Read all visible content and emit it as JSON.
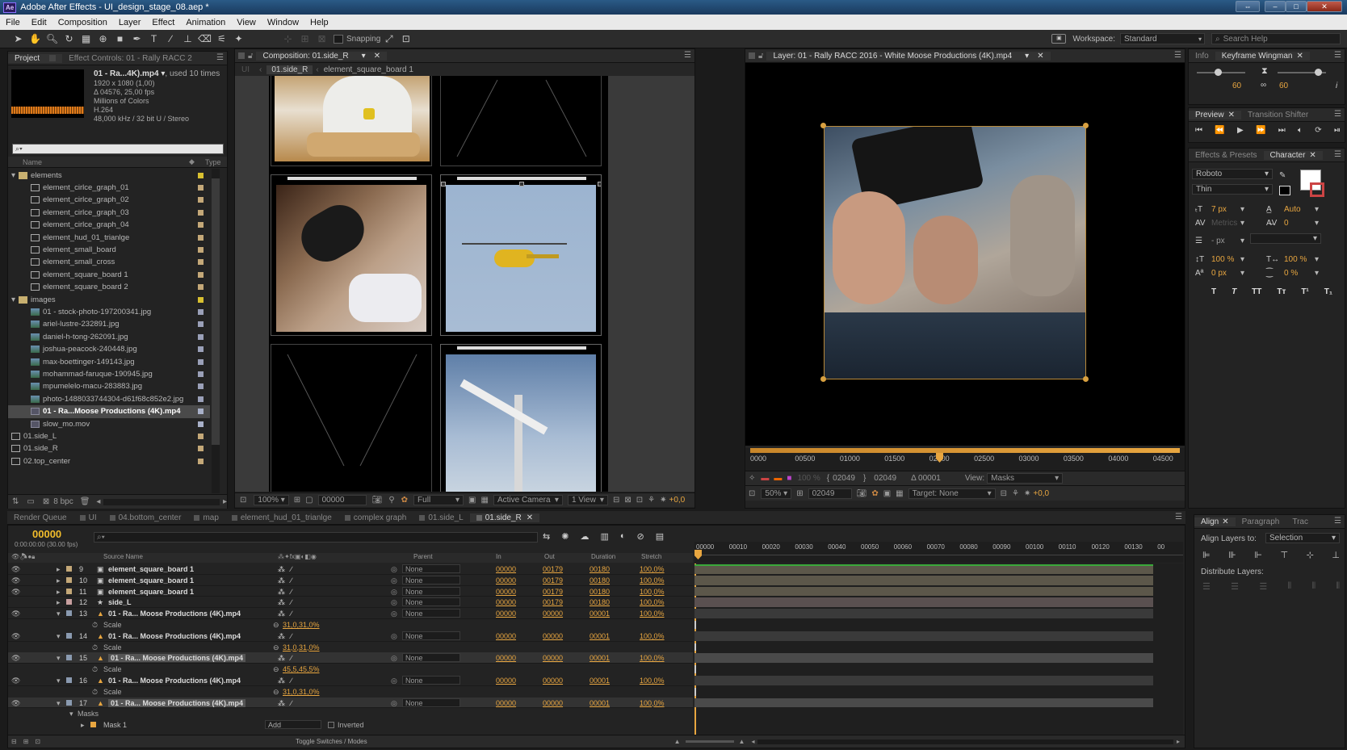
{
  "app": {
    "title": "Adobe After Effects - UI_design_stage_08.aep *",
    "badge": "Ae",
    "menus": [
      "File",
      "Edit",
      "Composition",
      "Layer",
      "Effect",
      "Animation",
      "View",
      "Window",
      "Help"
    ]
  },
  "toolbar": {
    "snapping_label": "Snapping",
    "workspace_label": "Workspace:",
    "workspace_value": "Standard",
    "search_placeholder": "Search Help"
  },
  "project": {
    "tabs": [
      "Project",
      "Effect Controls: 01 - Rally RACC 2"
    ],
    "info_name": "01 - Ra...4K).mp4",
    "info_used": ", used 10 times",
    "info_lines": [
      "1920 x 1080 (1,00)",
      "Δ 04576, 25,00 fps",
      "Millions of Colors",
      "H.264",
      "48,000 kHz / 32 bit U / Stereo"
    ],
    "col_name": "Name",
    "col_type": "Type",
    "items": [
      {
        "label": "elements",
        "kind": "folder"
      },
      {
        "label": "element_cirlce_graph_01",
        "kind": "comp"
      },
      {
        "label": "element_cirlce_graph_02",
        "kind": "comp"
      },
      {
        "label": "element_cirlce_graph_03",
        "kind": "comp"
      },
      {
        "label": "element_cirlce_graph_04",
        "kind": "comp"
      },
      {
        "label": "element_hud_01_trianlge",
        "kind": "comp"
      },
      {
        "label": "element_small_board",
        "kind": "comp"
      },
      {
        "label": "element_small_cross",
        "kind": "comp"
      },
      {
        "label": "element_square_board 1",
        "kind": "comp"
      },
      {
        "label": "element_square_board 2",
        "kind": "comp"
      },
      {
        "label": "images",
        "kind": "folder"
      },
      {
        "label": "01 - stock-photo-197200341.jpg",
        "kind": "image"
      },
      {
        "label": "ariel-lustre-232891.jpg",
        "kind": "image"
      },
      {
        "label": "daniel-h-tong-262091.jpg",
        "kind": "image"
      },
      {
        "label": "joshua-peacock-240448.jpg",
        "kind": "image"
      },
      {
        "label": "max-boettinger-149143.jpg",
        "kind": "image"
      },
      {
        "label": "mohammad-faruque-190945.jpg",
        "kind": "image"
      },
      {
        "label": "mpumelelo-macu-283883.jpg",
        "kind": "image"
      },
      {
        "label": "photo-1488033744304-d61f68c852e2.jpg",
        "kind": "image"
      },
      {
        "label": "01 - Ra...Moose Productions (4K).mp4",
        "kind": "video"
      },
      {
        "label": "slow_mo.mov",
        "kind": "video"
      },
      {
        "label": "01.side_L",
        "kind": "comp"
      },
      {
        "label": "01.side_R",
        "kind": "comp"
      },
      {
        "label": "02.top_center",
        "kind": "comp"
      }
    ],
    "bpc": "8 bpc"
  },
  "comp": {
    "tab": "Composition: 01.side_R",
    "crumbs": [
      "01.side_R",
      "element_square_board 1"
    ],
    "zoom": "100%",
    "timecode": "00000",
    "resolution": "Full",
    "camera": "Active Camera",
    "views": "1 View",
    "offset": "+0,0"
  },
  "layer": {
    "tab": "Layer: 01 - Rally RACC 2016 - White Moose Productions (4K).mp4",
    "ruler": [
      "0000",
      "00500",
      "01000",
      "01500",
      "02000",
      "02500",
      "03000",
      "03500",
      "04000",
      "04500"
    ],
    "zoom": "50%",
    "tc": "02049",
    "in": "02049",
    "out": "02049",
    "delta": "Δ 00001",
    "view_label": "View:",
    "view_value": "Masks",
    "target": "Target: None",
    "offset": "+0,0"
  },
  "right": {
    "info_tabs": [
      "Info",
      "Keyframe Wingman"
    ],
    "kw_values": [
      "60",
      "60"
    ],
    "preview_tabs": [
      "Preview",
      "Transition Shifter"
    ],
    "char_tabs": [
      "Effects & Presets",
      "Character"
    ],
    "font": "Roboto",
    "style": "Thin",
    "size": "7 px",
    "leading": "Auto",
    "kerning": "Metrics",
    "tracking": "0",
    "stroke": "- px",
    "vscale": "100 %",
    "hscale": "100 %",
    "baseline": "0 px",
    "tsume": "0 %",
    "styles": [
      "T",
      "T",
      "TT",
      "Tт",
      "T¹",
      "T₁"
    ],
    "align_tabs": [
      "Align",
      "Paragraph",
      "Trac"
    ],
    "align_to_label": "Align Layers to:",
    "align_to_value": "Selection",
    "distribute_label": "Distribute Layers:"
  },
  "timeline": {
    "tabs": [
      "Render Queue",
      "UI",
      "04.bottom_center",
      "map",
      "element_hud_01_trianlge",
      "complex graph",
      "01.side_L",
      "01.side_R"
    ],
    "timecode": "00000",
    "timecode_sub": "0:00:00:00 (30.00 fps)",
    "headers": {
      "source": "Source Name",
      "parent": "Parent",
      "in": "In",
      "out": "Out",
      "duration": "Duration",
      "stretch": "Stretch"
    },
    "ruler": [
      "00000",
      "00010",
      "00020",
      "00030",
      "00040",
      "00050",
      "00060",
      "00070",
      "00080",
      "00090",
      "00100",
      "00110",
      "00120",
      "00130",
      "00"
    ],
    "layers": [
      {
        "num": "9",
        "name": "element_square_board 1",
        "parent": "None",
        "in": "00000",
        "out": "00179",
        "dur": "00180",
        "stretch": "100,0%",
        "kind": "comp"
      },
      {
        "num": "10",
        "name": "element_square_board 1",
        "parent": "None",
        "in": "00000",
        "out": "00179",
        "dur": "00180",
        "stretch": "100,0%",
        "kind": "comp"
      },
      {
        "num": "11",
        "name": "element_square_board 1",
        "parent": "None",
        "in": "00000",
        "out": "00179",
        "dur": "00180",
        "stretch": "100,0%",
        "kind": "comp"
      },
      {
        "num": "12",
        "name": "side_L",
        "parent": "None",
        "in": "00000",
        "out": "00179",
        "dur": "00180",
        "stretch": "100,0%",
        "kind": "star"
      },
      {
        "num": "13",
        "name": "01 - Ra... Moose Productions (4K).mp4",
        "parent": "None",
        "in": "00000",
        "out": "00000",
        "dur": "00001",
        "stretch": "100,0%",
        "kind": "video",
        "prop": "Scale",
        "prop_value": "31,0,31,0%"
      },
      {
        "num": "14",
        "name": "01 - Ra... Moose Productions (4K).mp4",
        "parent": "None",
        "in": "00000",
        "out": "00000",
        "dur": "00001",
        "stretch": "100,0%",
        "kind": "video",
        "prop": "Scale",
        "prop_value": "31,0,31,0%"
      },
      {
        "num": "15",
        "name": "01 - Ra... Moose Productions (4K).mp4",
        "parent": "None",
        "in": "00000",
        "out": "00000",
        "dur": "00001",
        "stretch": "100,0%",
        "kind": "video",
        "prop": "Scale",
        "prop_value": "45,5,45,5%",
        "selected": true
      },
      {
        "num": "16",
        "name": "01 - Ra... Moose Productions (4K).mp4",
        "parent": "None",
        "in": "00000",
        "out": "00000",
        "dur": "00001",
        "stretch": "100,0%",
        "kind": "video",
        "prop": "Scale",
        "prop_value": "31,0,31,0%"
      },
      {
        "num": "17",
        "name": "01 - Ra... Moose Productions (4K).mp4",
        "parent": "None",
        "in": "00000",
        "out": "00000",
        "dur": "00001",
        "stretch": "100,0%",
        "kind": "video",
        "selected": true
      }
    ],
    "masks_label": "Masks",
    "mask_name": "Mask 1",
    "mask_mode": "Add",
    "mask_inverted": "Inverted",
    "toggle_label": "Toggle Switches / Modes"
  }
}
